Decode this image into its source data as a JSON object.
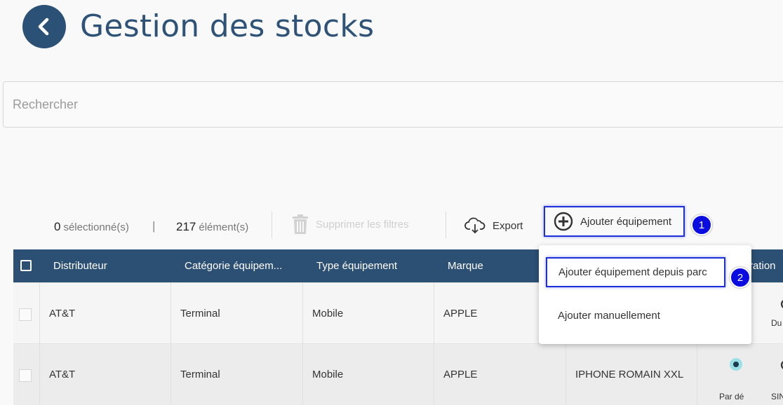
{
  "header": {
    "title": "Gestion des stocks",
    "back_icon": "chevron-left-icon"
  },
  "search": {
    "placeholder": "Rechercher",
    "value": ""
  },
  "toolbar": {
    "selected_count": "0",
    "selected_label": "sélectionné(s)",
    "separator": "|",
    "total_count": "217",
    "total_label": "élément(s)",
    "clear_filters_label": "Supprimer les filtres",
    "export_label": "Export",
    "add_label": "Ajouter équipement",
    "add_step": "1"
  },
  "table": {
    "headers": [
      "Distributeur",
      "Catégorie équipem...",
      "Type équipement",
      "Marque",
      "ration"
    ],
    "rows": [
      {
        "distributeur": "AT&T",
        "categorie": "Terminal",
        "type": "Mobile",
        "marque": "APPLE",
        "modele": "",
        "extra": "Du"
      },
      {
        "distributeur": "AT&T",
        "categorie": "Terminal",
        "type": "Mobile",
        "marque": "APPLE",
        "modele": "IPHONE ROMAIN XXL",
        "tag": "Par dé",
        "extra": "SIN"
      }
    ]
  },
  "dropdown": {
    "items": [
      "Ajouter équipement depuis parc",
      "Ajouter manuellement"
    ],
    "step": "2"
  },
  "colors": {
    "primary": "#2c4f74",
    "title": "#2f5378",
    "highlight": "#1c2fd8",
    "step_badge": "#0b0de0"
  }
}
